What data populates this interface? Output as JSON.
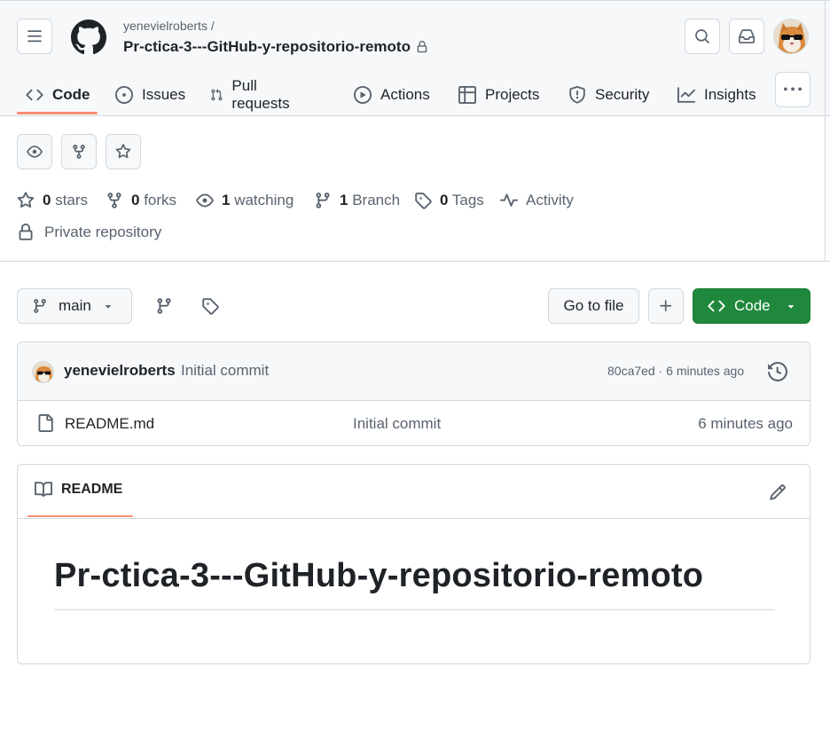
{
  "header": {
    "owner": "yenevielroberts /",
    "repo_name": "Pr-ctica-3---GitHub-y-repositorio-remoto"
  },
  "tabs": [
    {
      "label": "Code",
      "icon": "code-icon"
    },
    {
      "label": "Issues",
      "icon": "issue-opened-icon"
    },
    {
      "label": "Pull requests",
      "icon": "git-pull-request-icon"
    },
    {
      "label": "Actions",
      "icon": "play-icon"
    },
    {
      "label": "Projects",
      "icon": "table-icon"
    },
    {
      "label": "Security",
      "icon": "shield-icon"
    },
    {
      "label": "Insights",
      "icon": "graph-icon"
    }
  ],
  "stats": {
    "stars_count": "0",
    "stars_label": "stars",
    "forks_count": "0",
    "forks_label": "forks",
    "watching_count": "1",
    "watching_label": "watching",
    "branch_count": "1",
    "branch_label": "Branch",
    "tags_count": "0",
    "tags_label": "Tags",
    "activity_label": "Activity",
    "private_label": "Private repository"
  },
  "toolbar": {
    "branch": "main",
    "goto_file": "Go to file",
    "code_button": "Code"
  },
  "latest_commit": {
    "author": "yenevielroberts",
    "message": "Initial commit",
    "meta": "80ca7ed · 6 minutes ago"
  },
  "files": [
    {
      "name": "README.md",
      "commit": "Initial commit",
      "age": "6 minutes ago"
    }
  ],
  "readme": {
    "tab_label": "README",
    "heading": "Pr-ctica-3---GitHub-y-repositorio-remoto"
  },
  "colors": {
    "accent_underline": "#fd8c73",
    "code_button_bg": "#1f883d",
    "header_bg": "#f6f8fa",
    "border": "#d1d9e0"
  }
}
